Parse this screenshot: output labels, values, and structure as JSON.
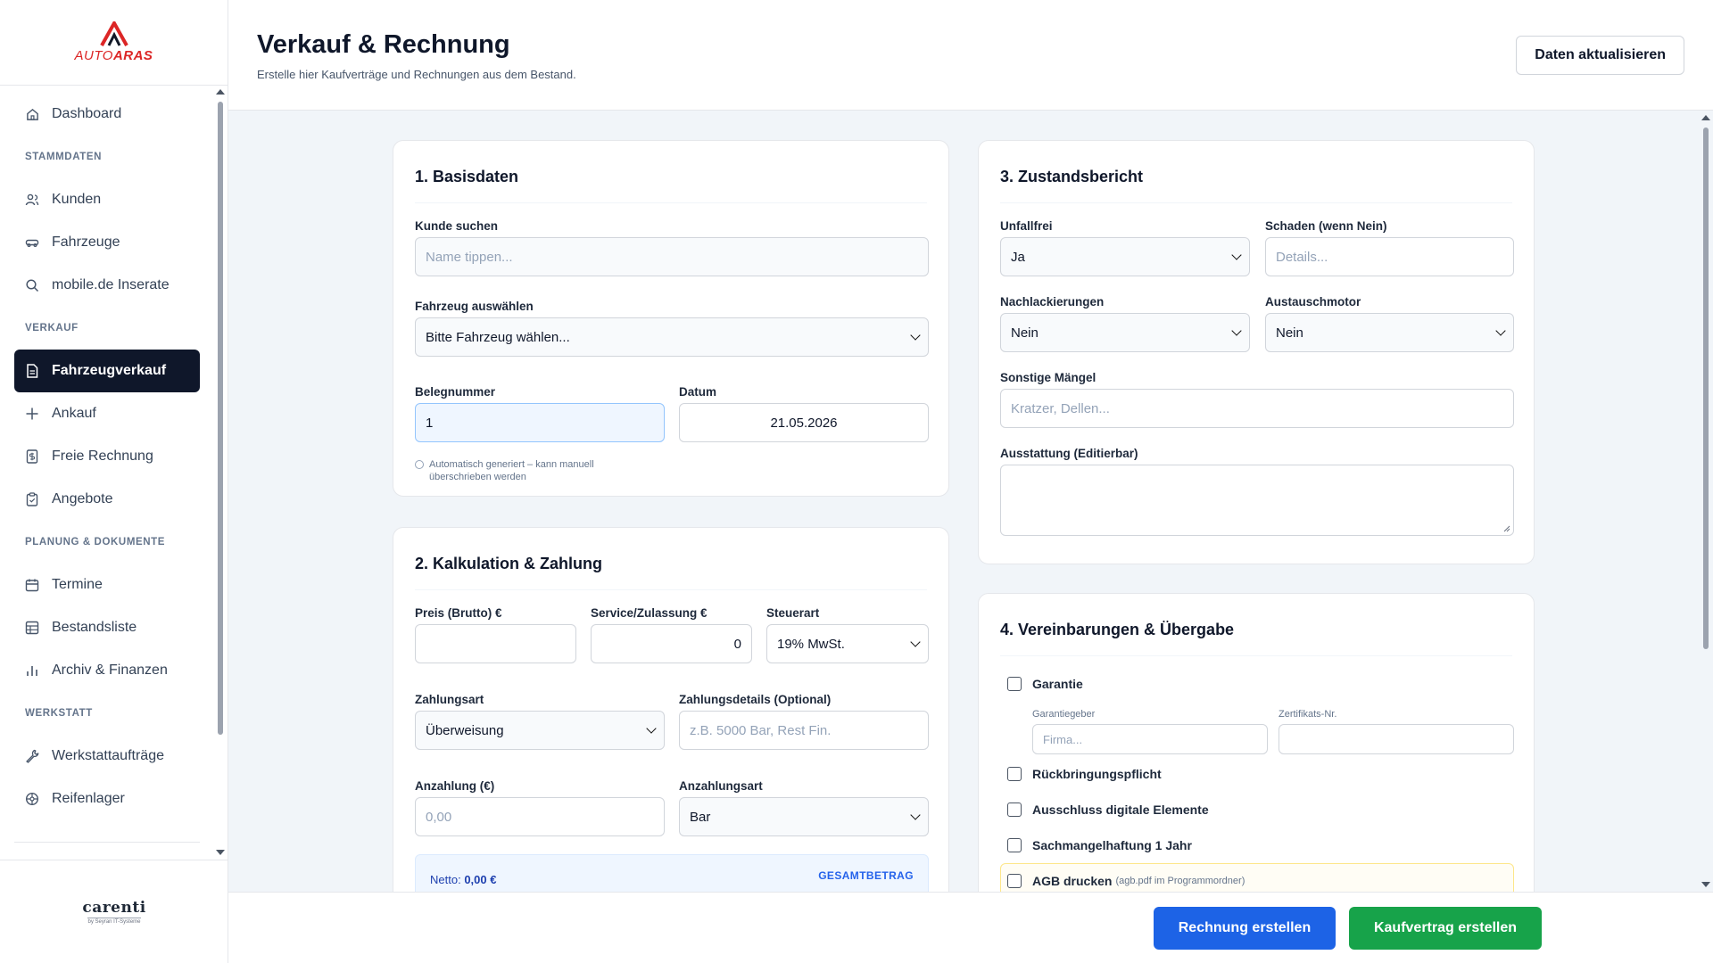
{
  "brand": {
    "logo_text_1": "AUTO",
    "logo_text_2": "ARAS",
    "footer_logo": "carenti",
    "footer_sub": "by Seyran IT-Systeme"
  },
  "sidebar": {
    "dashboard": "Dashboard",
    "sec_stammdaten": "STAMMDATEN",
    "kunden": "Kunden",
    "fahrzeuge": "Fahrzeuge",
    "mobile": "mobile.de Inserate",
    "sec_verkauf": "VERKAUF",
    "fahrzeugverkauf": "Fahrzeugverkauf",
    "ankauf": "Ankauf",
    "freie_rechnung": "Freie Rechnung",
    "angebote": "Angebote",
    "sec_planung": "PLANUNG & DOKUMENTE",
    "termine": "Termine",
    "bestandsliste": "Bestandsliste",
    "archiv": "Archiv & Finanzen",
    "sec_werkstatt": "WERKSTATT",
    "werkstatt": "Werkstattaufträge",
    "reifen": "Reifenlager"
  },
  "header": {
    "title": "Verkauf & Rechnung",
    "subtitle": "Erstelle hier Kaufverträge und Rechnungen aus dem Bestand.",
    "refresh": "Daten aktualisieren"
  },
  "basis": {
    "title": "1. Basisdaten",
    "kunde_label": "Kunde suchen",
    "kunde_placeholder": "Name tippen...",
    "fahrzeug_label": "Fahrzeug auswählen",
    "fahrzeug_value": "Bitte Fahrzeug wählen...",
    "beleg_label": "Belegnummer",
    "beleg_value": "1",
    "datum_label": "Datum",
    "datum_value": "21.05.2026",
    "hint": "Automatisch generiert – kann manuell überschrieben werden"
  },
  "kalk": {
    "title": "2. Kalkulation & Zahlung",
    "preis_label": "Preis (Brutto) €",
    "service_label": "Service/Zulassung €",
    "service_value": "0",
    "steuer_label": "Steuerart",
    "steuer_value": "19% MwSt.",
    "zahlungsart_label": "Zahlungsart",
    "zahlungsart_value": "Überweisung",
    "details_label": "Zahlungsdetails (Optional)",
    "details_placeholder": "z.B. 5000 Bar, Rest Fin.",
    "anzahlung_label": "Anzahlung (€)",
    "anzahlung_placeholder": "0,00",
    "anzahlungsart_label": "Anzahlungsart",
    "anzahlungsart_value": "Bar",
    "netto_label": "Netto:",
    "netto_value": "0,00 €",
    "gesamt_label": "GESAMTBETRAG"
  },
  "zustand": {
    "title": "3. Zustandsbericht",
    "unfallfrei_label": "Unfallfrei",
    "unfallfrei_value": "Ja",
    "schaden_label": "Schaden (wenn Nein)",
    "schaden_placeholder": "Details...",
    "lack_label": "Nachlackierungen",
    "lack_value": "Nein",
    "motor_label": "Austauschmotor",
    "motor_value": "Nein",
    "maengel_label": "Sonstige Mängel",
    "maengel_placeholder": "Kratzer, Dellen...",
    "ausstattung_label": "Ausstattung (Editierbar)"
  },
  "verein": {
    "title": "4. Vereinbarungen & Übergabe",
    "garantie": "Garantie",
    "garantiegeber_label": "Garantiegeber",
    "garantiegeber_placeholder": "Firma...",
    "zert_label": "Zertifikats-Nr.",
    "rueck": "Rückbringungspflicht",
    "ausschluss": "Ausschluss digitale Elemente",
    "sach": "Sachmangelhaftung 1 Jahr",
    "agb": "AGB drucken",
    "agb_note": "(agb.pdf im Programmordner)"
  },
  "footer": {
    "rechnung": "Rechnung erstellen",
    "kaufvertrag": "Kaufvertrag erstellen"
  }
}
